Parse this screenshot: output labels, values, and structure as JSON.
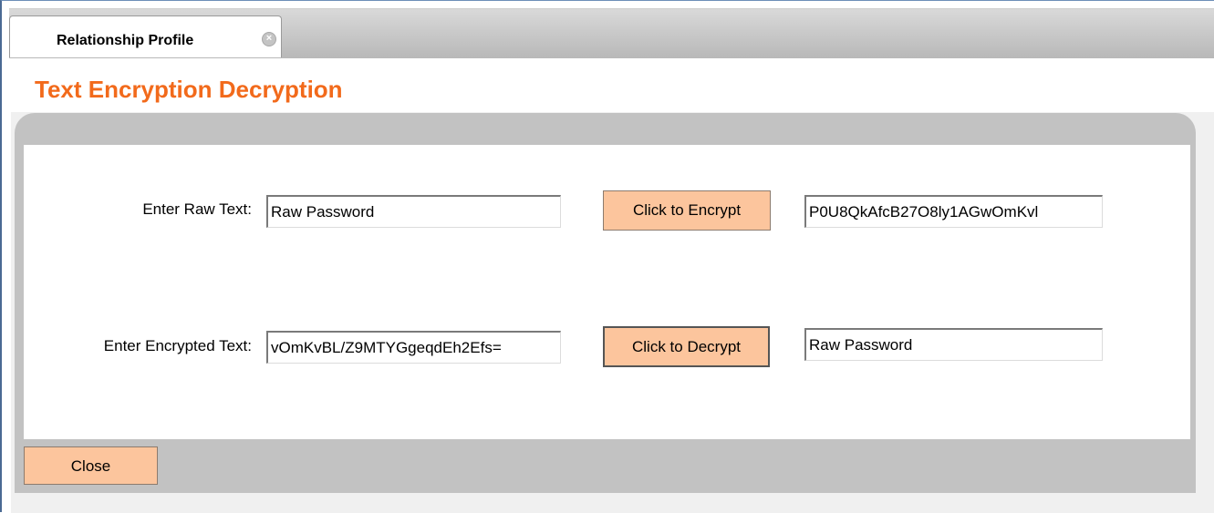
{
  "tabs": [
    {
      "label": "Relationship Profile",
      "close_icon": "close-circle-icon",
      "active": true
    }
  ],
  "page": {
    "title": "Text Encryption Decryption",
    "title_color": "#f26a1b"
  },
  "encrypt_row": {
    "label": "Enter Raw Text:",
    "input_value": "Raw Password",
    "button_label": "Click to Encrypt",
    "result_value": "P0U8QkAfcB27O8ly1AGwOmKvl"
  },
  "decrypt_row": {
    "label": "Enter Encrypted Text:",
    "input_value": "vOmKvBL/Z9MTYGgeqdEh2Efs=",
    "button_label": "Click to Decrypt",
    "result_value": "Raw Password"
  },
  "footer": {
    "close_label": "Close"
  },
  "colors": {
    "button_bg": "#fcc59d",
    "panel_gray": "#c2c2c2"
  }
}
